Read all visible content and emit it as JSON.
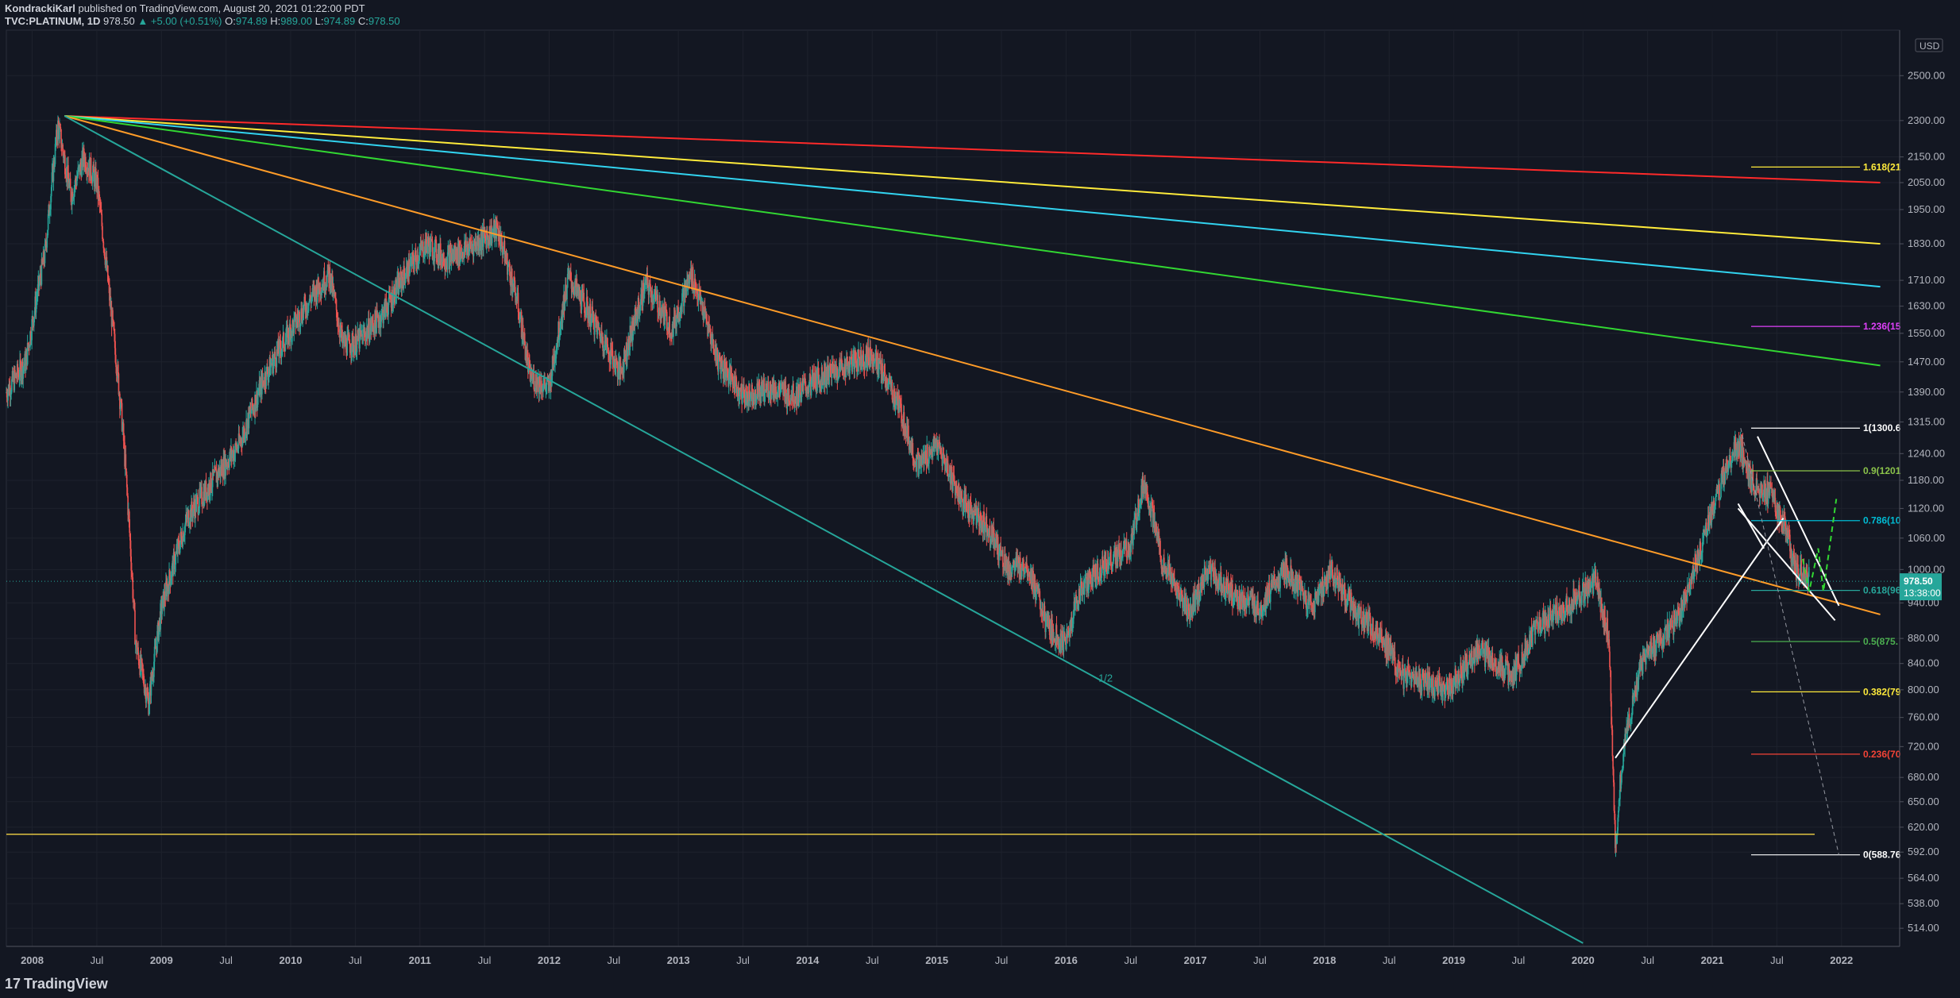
{
  "header": {
    "author": "KondrackiKarl",
    "published_text": "published on TradingView.com, August 20, 2021 01:22:00 PDT",
    "symbol": "TVC:PLATINUM, 1D",
    "last": "978.50",
    "change": "▲ +5.00 (+0.51%)",
    "open_label": "O:",
    "open": "974.89",
    "high_label": "H:",
    "high": "989.00",
    "low_label": "L:",
    "low": "974.89",
    "close_label": "C:",
    "close": "978.50"
  },
  "footer": {
    "logo_text": "TradingView"
  },
  "colors": {
    "background": "#131722",
    "grid": "#1e222d",
    "axis_text": "#b2b5be",
    "up": "#26a69a",
    "down": "#ef5350"
  },
  "chart_data": {
    "type": "candlestick",
    "title": "",
    "currency_label": "USD",
    "last_price_label": "978.50",
    "countdown_label": "13:38:00",
    "y_ticks": [
      "2500.00",
      "2300.00",
      "2150.00",
      "2050.00",
      "1950.00",
      "1830.00",
      "1710.00",
      "1630.00",
      "1550.00",
      "1470.00",
      "1390.00",
      "1315.00",
      "1240.00",
      "1180.00",
      "1120.00",
      "1060.00",
      "1000.00",
      "940.00",
      "880.00",
      "840.00",
      "800.00",
      "760.00",
      "720.00",
      "680.00",
      "650.00",
      "620.00",
      "592.00",
      "564.00",
      "538.00",
      "514.00"
    ],
    "x_ticks": [
      {
        "label": "2008",
        "t": 2008.0,
        "major": true
      },
      {
        "label": "Jul",
        "t": 2008.5
      },
      {
        "label": "2009",
        "t": 2009.0,
        "major": true
      },
      {
        "label": "Jul",
        "t": 2009.5
      },
      {
        "label": "2010",
        "t": 2010.0,
        "major": true
      },
      {
        "label": "Jul",
        "t": 2010.5
      },
      {
        "label": "2011",
        "t": 2011.0,
        "major": true
      },
      {
        "label": "Jul",
        "t": 2011.5
      },
      {
        "label": "2012",
        "t": 2012.0,
        "major": true
      },
      {
        "label": "Jul",
        "t": 2012.5
      },
      {
        "label": "2013",
        "t": 2013.0,
        "major": true
      },
      {
        "label": "Jul",
        "t": 2013.5
      },
      {
        "label": "2014",
        "t": 2014.0,
        "major": true
      },
      {
        "label": "Jul",
        "t": 2014.5
      },
      {
        "label": "2015",
        "t": 2015.0,
        "major": true
      },
      {
        "label": "Jul",
        "t": 2015.5
      },
      {
        "label": "2016",
        "t": 2016.0,
        "major": true
      },
      {
        "label": "Jul",
        "t": 2016.5
      },
      {
        "label": "2017",
        "t": 2017.0,
        "major": true
      },
      {
        "label": "Jul",
        "t": 2017.5
      },
      {
        "label": "2018",
        "t": 2018.0,
        "major": true
      },
      {
        "label": "Jul",
        "t": 2018.5
      },
      {
        "label": "2019",
        "t": 2019.0,
        "major": true
      },
      {
        "label": "Jul",
        "t": 2019.5
      },
      {
        "label": "2020",
        "t": 2020.0,
        "major": true
      },
      {
        "label": "Jul",
        "t": 2020.5
      },
      {
        "label": "2021",
        "t": 2021.0,
        "major": true
      },
      {
        "label": "Jul",
        "t": 2021.5
      },
      {
        "label": "2022",
        "t": 2022.0,
        "major": true
      }
    ],
    "price_path": [
      [
        2007.8,
        1390
      ],
      [
        2007.95,
        1470
      ],
      [
        2008.1,
        1800
      ],
      [
        2008.2,
        2280
      ],
      [
        2008.3,
        2000
      ],
      [
        2008.4,
        2150
      ],
      [
        2008.5,
        2050
      ],
      [
        2008.6,
        1650
      ],
      [
        2008.7,
        1300
      ],
      [
        2008.8,
        870
      ],
      [
        2008.9,
        780
      ],
      [
        2009.0,
        930
      ],
      [
        2009.2,
        1100
      ],
      [
        2009.4,
        1180
      ],
      [
        2009.6,
        1260
      ],
      [
        2009.8,
        1430
      ],
      [
        2010.0,
        1560
      ],
      [
        2010.2,
        1680
      ],
      [
        2010.3,
        1730
      ],
      [
        2010.4,
        1520
      ],
      [
        2010.5,
        1520
      ],
      [
        2010.7,
        1600
      ],
      [
        2010.9,
        1740
      ],
      [
        2011.05,
        1830
      ],
      [
        2011.2,
        1780
      ],
      [
        2011.35,
        1810
      ],
      [
        2011.6,
        1880
      ],
      [
        2011.75,
        1650
      ],
      [
        2011.85,
        1430
      ],
      [
        2012.0,
        1400
      ],
      [
        2012.15,
        1720
      ],
      [
        2012.35,
        1580
      ],
      [
        2012.55,
        1440
      ],
      [
        2012.75,
        1700
      ],
      [
        2012.95,
        1560
      ],
      [
        2013.1,
        1730
      ],
      [
        2013.3,
        1480
      ],
      [
        2013.5,
        1380
      ],
      [
        2013.7,
        1400
      ],
      [
        2013.9,
        1380
      ],
      [
        2014.1,
        1430
      ],
      [
        2014.3,
        1460
      ],
      [
        2014.5,
        1490
      ],
      [
        2014.7,
        1360
      ],
      [
        2014.85,
        1210
      ],
      [
        2015.0,
        1260
      ],
      [
        2015.2,
        1130
      ],
      [
        2015.4,
        1080
      ],
      [
        2015.55,
        1000
      ],
      [
        2015.7,
        1010
      ],
      [
        2015.85,
        900
      ],
      [
        2016.0,
        870
      ],
      [
        2016.1,
        960
      ],
      [
        2016.3,
        1010
      ],
      [
        2016.5,
        1040
      ],
      [
        2016.6,
        1180
      ],
      [
        2016.75,
        1010
      ],
      [
        2016.95,
        920
      ],
      [
        2017.1,
        1000
      ],
      [
        2017.3,
        950
      ],
      [
        2017.5,
        930
      ],
      [
        2017.7,
        1000
      ],
      [
        2017.9,
        930
      ],
      [
        2018.05,
        1000
      ],
      [
        2018.25,
        920
      ],
      [
        2018.45,
        880
      ],
      [
        2018.6,
        820
      ],
      [
        2018.8,
        810
      ],
      [
        2018.95,
        800
      ],
      [
        2019.2,
        860
      ],
      [
        2019.45,
        820
      ],
      [
        2019.65,
        900
      ],
      [
        2019.85,
        930
      ],
      [
        2020.0,
        960
      ],
      [
        2020.1,
        980
      ],
      [
        2020.2,
        880
      ],
      [
        2020.25,
        590
      ],
      [
        2020.3,
        700
      ],
      [
        2020.45,
        840
      ],
      [
        2020.6,
        880
      ],
      [
        2020.75,
        920
      ],
      [
        2020.95,
        1070
      ],
      [
        2021.1,
        1200
      ],
      [
        2021.2,
        1270
      ],
      [
        2021.3,
        1180
      ],
      [
        2021.45,
        1150
      ],
      [
        2021.55,
        1090
      ],
      [
        2021.65,
        1000
      ],
      [
        2021.75,
        990
      ]
    ],
    "trend_lines": [
      {
        "color": "#ff2a2a",
        "from": [
          2008.25,
          2320
        ],
        "to": [
          2022.3,
          2050
        ]
      },
      {
        "color": "#ffeb3b",
        "from": [
          2008.25,
          2320
        ],
        "to": [
          2022.3,
          1830
        ]
      },
      {
        "color": "#32d4f0",
        "from": [
          2008.25,
          2320
        ],
        "to": [
          2022.3,
          1690
        ]
      },
      {
        "color": "#32d732",
        "from": [
          2008.25,
          2320
        ],
        "to": [
          2022.3,
          1460
        ]
      },
      {
        "color": "#ff9c28",
        "from": [
          2008.25,
          2320
        ],
        "to": [
          2022.3,
          920
        ]
      },
      {
        "color": "#26a69a",
        "from": [
          2008.25,
          2320
        ],
        "to": [
          2020.0,
          500
        ]
      },
      {
        "color": "#ffffff",
        "from": [
          2020.25,
          705
        ],
        "to": [
          2021.55,
          1100
        ]
      },
      {
        "color": "#ffffff",
        "from": [
          2021.2,
          1120
        ],
        "to": [
          2021.95,
          910
        ]
      },
      {
        "color": "#ffffff",
        "from": [
          2021.35,
          1280
        ],
        "to": [
          2021.98,
          935
        ]
      },
      {
        "color": "#ffffff",
        "from": [
          2021.2,
          1130
        ],
        "to": [
          2021.4,
          1040
        ]
      }
    ],
    "support_line": {
      "value": 612,
      "color": "#e0c341"
    },
    "gann_label": {
      "text": "1/2",
      "t": 2016.25,
      "value": 812,
      "color": "#26a69a"
    },
    "fib_levels": [
      {
        "label": "1.618(21",
        "value": 2110,
        "color": "#ffeb3b"
      },
      {
        "label": "1.236(15",
        "value": 1570,
        "color": "#e040fb"
      },
      {
        "label": "1(1300.6",
        "value": 1300,
        "color": "#ffffff"
      },
      {
        "label": "0.9(1201",
        "value": 1201,
        "color": "#8bc34a"
      },
      {
        "label": "0.786(10",
        "value": 1095,
        "color": "#00bcd4"
      },
      {
        "label": "0.618(96",
        "value": 962,
        "color": "#26a69a"
      },
      {
        "label": "0.5(875.",
        "value": 875,
        "color": "#4caf50"
      },
      {
        "label": "0.382(79",
        "value": 797,
        "color": "#ffeb3b"
      },
      {
        "label": "0.236(70",
        "value": 710,
        "color": "#f44336"
      },
      {
        "label": "0(588.76",
        "value": 589,
        "color": "#ffffff"
      }
    ],
    "projection_path": [
      [
        2021.7,
        1020
      ],
      [
        2021.75,
        960
      ],
      [
        2021.82,
        1040
      ],
      [
        2021.86,
        960
      ],
      [
        2021.96,
        1140
      ]
    ],
    "last_price": 978.5
  }
}
